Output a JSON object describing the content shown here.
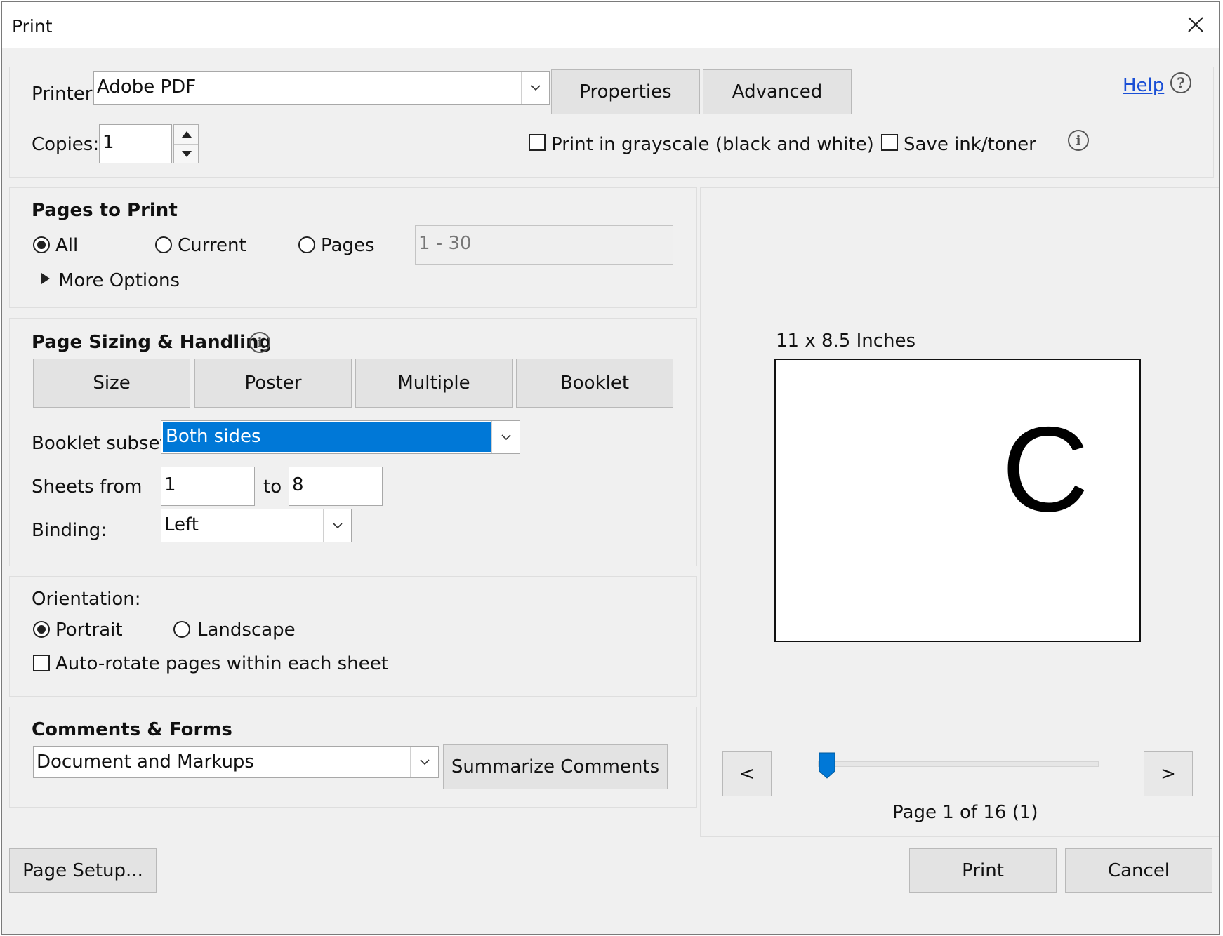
{
  "window": {
    "title": "Print"
  },
  "printer": {
    "label": "Printer:",
    "value": "Adobe PDF",
    "properties_label": "Properties",
    "advanced_label": "Advanced",
    "help_label": "Help"
  },
  "copies": {
    "label": "Copies:",
    "value": "1"
  },
  "options": {
    "grayscale_label": "Print in grayscale (black and white)",
    "save_ink_label": "Save ink/toner",
    "grayscale_checked": false,
    "save_ink_checked": false
  },
  "pages_to_print": {
    "heading": "Pages to Print",
    "all_label": "All",
    "current_label": "Current",
    "pages_label": "Pages",
    "pages_placeholder": "1 - 30",
    "selected": "All",
    "more_options_label": "More Options"
  },
  "page_sizing": {
    "heading": "Page Sizing & Handling",
    "tabs": [
      "Size",
      "Poster",
      "Multiple",
      "Booklet"
    ],
    "booklet_subset_label": "Booklet subset:",
    "booklet_subset_value": "Both sides",
    "sheets_from_label": "Sheets from",
    "sheets_from_value": "1",
    "to_label": "to",
    "sheets_to_value": "8",
    "binding_label": "Binding:",
    "binding_value": "Left"
  },
  "orientation": {
    "label": "Orientation:",
    "portrait_label": "Portrait",
    "landscape_label": "Landscape",
    "selected": "Portrait",
    "auto_rotate_label": "Auto-rotate pages within each sheet",
    "auto_rotate_checked": false
  },
  "comments_forms": {
    "heading": "Comments & Forms",
    "value": "Document and Markups",
    "summarize_label": "Summarize Comments"
  },
  "preview": {
    "size_label": "11 x 8.5 Inches",
    "page_letter": "C",
    "prev_label": "<",
    "next_label": ">",
    "page_status": "Page 1 of 16 (1)",
    "slider_position": 0.0
  },
  "footer": {
    "page_setup_label": "Page Setup...",
    "print_label": "Print",
    "cancel_label": "Cancel"
  },
  "colors": {
    "accent": "#0078d7",
    "link": "#1a4fd6",
    "dialog_bg": "#f0f0f0"
  }
}
